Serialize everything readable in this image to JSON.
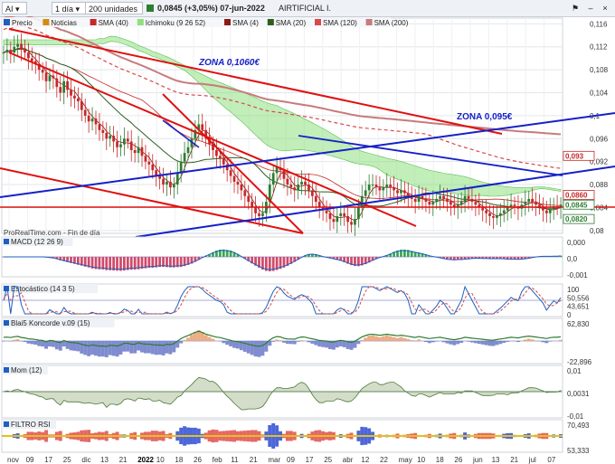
{
  "toolbar": {
    "symbol": "AI",
    "timeframe": "1 día",
    "units": "200 unidades",
    "price_change": "0,0845 (+3,05%) 07-jun-2022",
    "instrument": "AIRTIFICIAL I."
  },
  "legend": {
    "precio": "Precio",
    "noticias": "Noticias",
    "sma40": "SMA (40)",
    "ichimoku": "Ichimoku (9 26 52)",
    "sma4": "SMA (4)",
    "sma20": "SMA (20)",
    "sma120": "SMA (120)",
    "sma200": "SMA (200)"
  },
  "colors": {
    "up": "#2e7d32",
    "down": "#c62828",
    "sma40": "#c62828",
    "sma4": "#8b1a1a",
    "sma20": "#2e5e1e",
    "sma120": "#d84a4a",
    "sma200": "#c77b7b",
    "cloud": "#8ee07f",
    "trend_red": "#e01010",
    "trend_blue": "#1520c8"
  },
  "annotations": {
    "zona1": "ZONA 0,1060€",
    "zona2": "ZONA 0,095€",
    "source": "ProRealTime.com - Fin de día"
  },
  "axis": {
    "price_ticks": [
      "0,116",
      "0,112",
      "0,108",
      "0,104",
      "0,1",
      "0,096",
      "0,092",
      "0,088",
      "0,084",
      "0,08"
    ],
    "price_tick_values": [
      0.116,
      0.112,
      0.108,
      0.104,
      0.1,
      0.096,
      0.092,
      0.088,
      0.084,
      0.08
    ],
    "price_labels": [
      {
        "text": "0,093",
        "value": 0.093,
        "color": "#c62828"
      },
      {
        "text": "0,0860",
        "value": 0.0862,
        "color": "#c62828"
      },
      {
        "text": "0,0845",
        "value": 0.0845,
        "color": "#2e7d32"
      },
      {
        "text": "0,0820",
        "value": 0.082,
        "color": "#2e7d32"
      }
    ],
    "x_labels": [
      "nov",
      "09",
      "17",
      "25",
      "dic",
      "13",
      "21",
      "2022",
      "10",
      "18",
      "26",
      "feb",
      "11",
      "21",
      "mar",
      "09",
      "17",
      "25",
      "abr",
      "12",
      "22",
      "may",
      "10",
      "18",
      "26",
      "jun",
      "13",
      "21",
      "jul",
      "07"
    ]
  },
  "panels": {
    "macd": {
      "title": "MACD (12 26 9)",
      "ticks": [
        "0,000",
        "0,0",
        "-0,001"
      ]
    },
    "stoch": {
      "title": "Estocástico (14 3 5)",
      "ticks": [
        "100",
        "50,556",
        "43,651",
        "0"
      ]
    },
    "koncorde": {
      "title": "Blai5 Koncorde v.09 (15)",
      "ticks": [
        "62,830",
        "-22,896"
      ]
    },
    "mom": {
      "title": "Mom (12)",
      "ticks": [
        "0,01",
        "0,0031",
        "-0,01"
      ]
    },
    "rsi": {
      "title": "FILTRO RSI",
      "ticks": [
        "70,493",
        "53,333"
      ]
    }
  },
  "chart_data": {
    "type": "candlestick",
    "title": "AIRTIFICIAL I.",
    "ylim": [
      0.0795,
      0.117
    ],
    "n_sessions": 158,
    "close": [
      0.111,
      0.1115,
      0.111,
      0.112,
      0.1125,
      0.1115,
      0.111,
      0.11,
      0.1095,
      0.109,
      0.108,
      0.1075,
      0.106,
      0.107,
      0.1065,
      0.105,
      0.104,
      0.106,
      0.1045,
      0.1035,
      0.103,
      0.1025,
      0.101,
      0.1,
      0.099,
      0.0995,
      0.0985,
      0.0975,
      0.097,
      0.096,
      0.0965,
      0.0955,
      0.0945,
      0.095,
      0.096,
      0.0955,
      0.094,
      0.0935,
      0.0945,
      0.093,
      0.092,
      0.0915,
      0.0905,
      0.0895,
      0.089,
      0.088,
      0.0885,
      0.0875,
      0.088,
      0.09,
      0.092,
      0.0935,
      0.0945,
      0.096,
      0.0975,
      0.0985,
      0.0975,
      0.096,
      0.095,
      0.094,
      0.093,
      0.0925,
      0.0915,
      0.0905,
      0.0895,
      0.0885,
      0.088,
      0.087,
      0.086,
      0.085,
      0.084,
      0.083,
      0.0825,
      0.083,
      0.085,
      0.088,
      0.09,
      0.091,
      0.0905,
      0.089,
      0.088,
      0.0875,
      0.087,
      0.088,
      0.0885,
      0.088,
      0.087,
      0.086,
      0.085,
      0.084,
      0.0835,
      0.083,
      0.082,
      0.0815,
      0.0825,
      0.083,
      0.0825,
      0.0815,
      0.081,
      0.082,
      0.084,
      0.086,
      0.087,
      0.088,
      0.088,
      0.0875,
      0.087,
      0.0875,
      0.088,
      0.0875,
      0.087,
      0.0865,
      0.087,
      0.0865,
      0.086,
      0.0855,
      0.085,
      0.086,
      0.0855,
      0.085,
      0.0845,
      0.085,
      0.0855,
      0.086,
      0.0855,
      0.085,
      0.0845,
      0.084,
      0.0845,
      0.085,
      0.086,
      0.0855,
      0.085,
      0.0845,
      0.084,
      0.0835,
      0.083,
      0.0825,
      0.0822,
      0.0826,
      0.083,
      0.0835,
      0.084,
      0.0845,
      0.0842,
      0.0838,
      0.0845,
      0.085,
      0.0855,
      0.085,
      0.0845,
      0.084,
      0.0835,
      0.083,
      0.0838,
      0.0842,
      0.084,
      0.0845
    ]
  }
}
